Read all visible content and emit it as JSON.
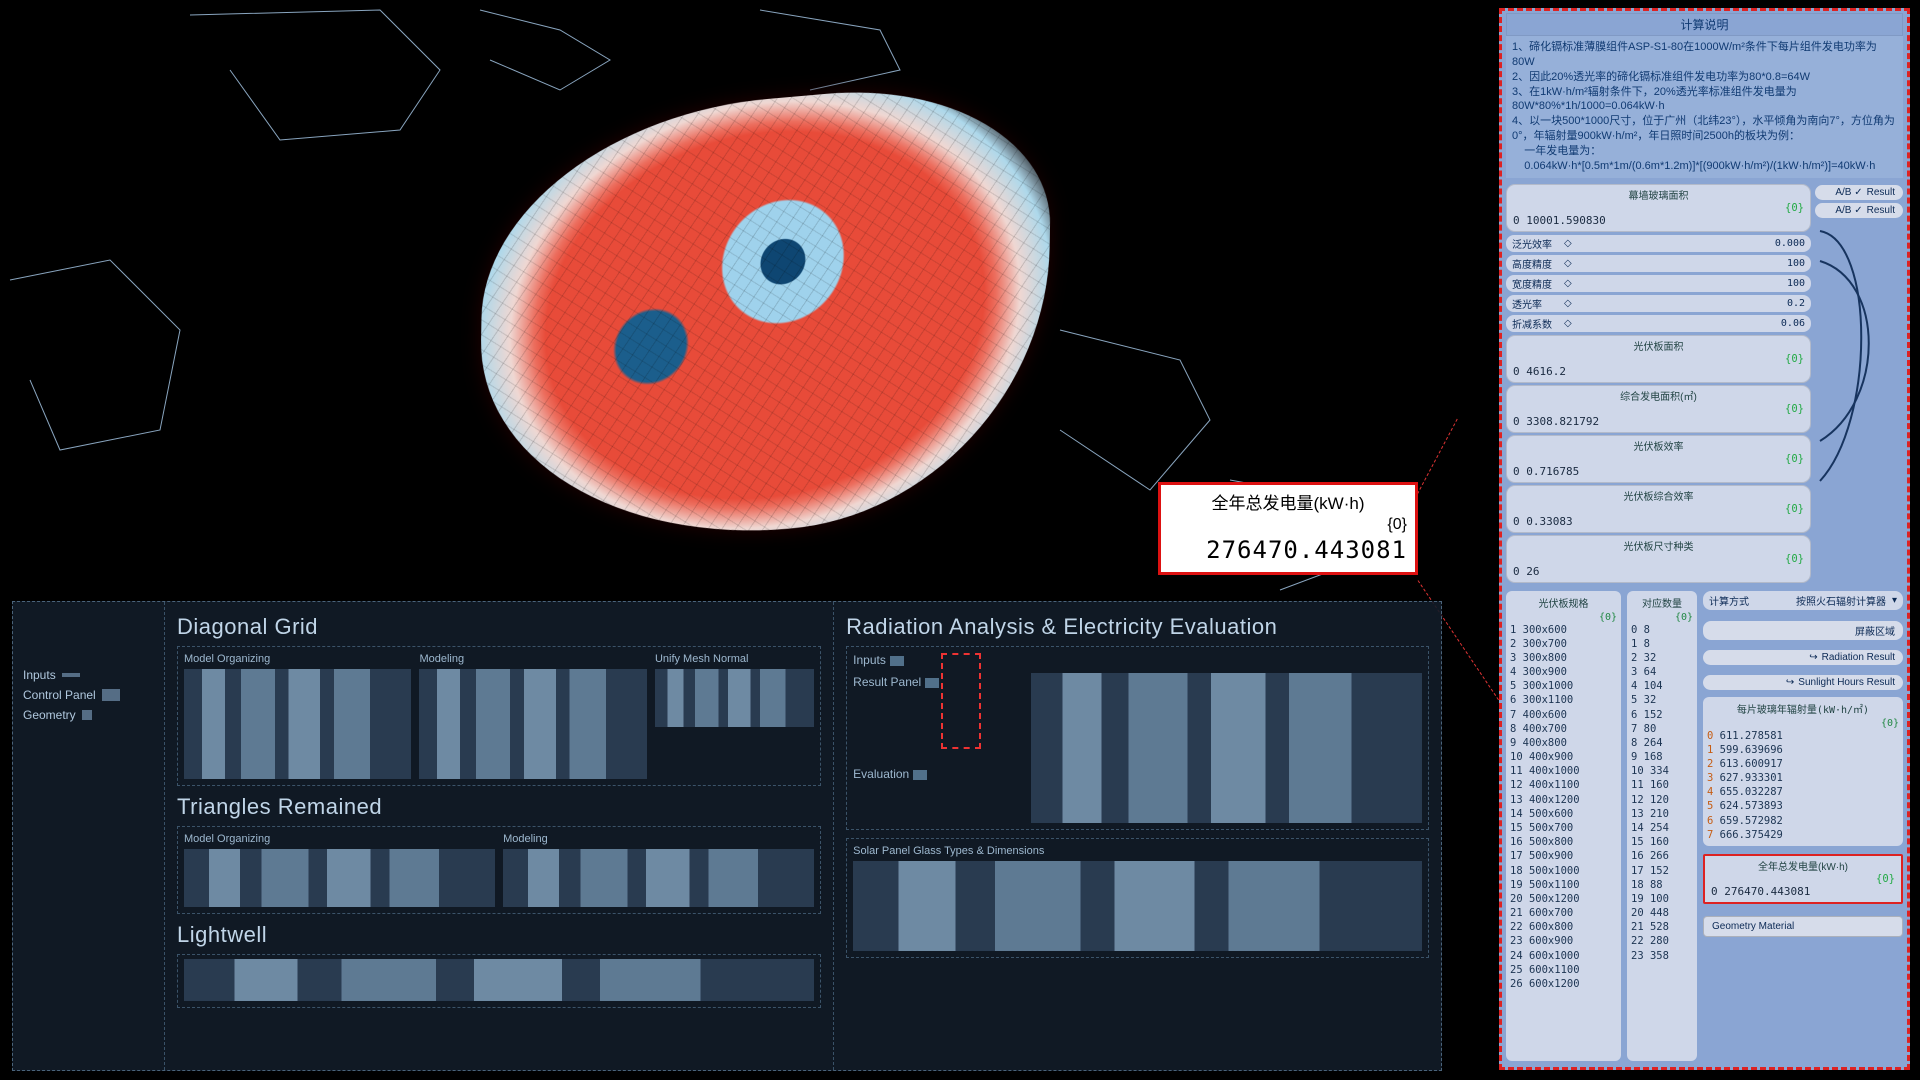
{
  "callout": {
    "title": "全年总发电量(kW·h)",
    "zero": "{0}",
    "value": "276470.443081"
  },
  "bottom": {
    "legend": {
      "inputs": "Inputs",
      "control_panel": "Control Panel",
      "geometry": "Geometry"
    },
    "diagonal": {
      "title": "Diagonal Grid",
      "model_org": "Model Organizing",
      "modeling": "Modeling",
      "unify": "Unify Mesh Normal"
    },
    "triangles": {
      "title": "Triangles Remained",
      "model_org": "Model Organizing",
      "modeling": "Modeling"
    },
    "lightwell": {
      "title": "Lightwell"
    },
    "rad": {
      "title": "Radiation Analysis & Electricity Evaluation",
      "inputs": "Inputs",
      "result_panel": "Result Panel",
      "evaluation": "Evaluation",
      "solar_types": "Solar Panel Glass Types & Dimensions"
    }
  },
  "inspector": {
    "title": "计算说明",
    "text": "1、碲化镉标准薄膜组件ASP-S1-80在1000W/m²条件下每片组件发电功率为80W\n2、因此20%透光率的碲化镉标准组件发电功率为80*0.8=64W\n3、在1kW·h/m²辐射条件下，20%透光率标准组件发电量为 80W*80%*1h/1000=0.064kW·h\n4、以一块500*1000尺寸，位于广州（北纬23°），水平倾角为南向7°，方位角为0°，年辐射量900kW·h/m²，年日照时间2500h的板块为例：\n    一年发电量为：\n    0.064kW·h*[0.5m*1m/(0.6m*1.2m)]*[(900kW·h/m²)/(1kW·h/m²)]=40kW·h",
    "sliders": [
      {
        "name": "泛光效率",
        "val": "0.000"
      },
      {
        "name": "高度精度",
        "val": "100"
      },
      {
        "name": "宽度精度",
        "val": "100"
      },
      {
        "name": "透光率",
        "val": "0.2"
      },
      {
        "name": "折减系数",
        "val": "0.06"
      }
    ],
    "readouts": {
      "glass_area": {
        "label": "幕墙玻璃面积",
        "zero": "{0}",
        "val": "0 10001.590830"
      },
      "pv_area": {
        "label": "光伏板面积",
        "zero": "{0}",
        "val": "0 4616.2"
      },
      "gen_area": {
        "label": "综合发电面积(㎡)",
        "zero": "{0}",
        "val": "0 3308.821792"
      },
      "pv_eff": {
        "label": "光伏板效率",
        "zero": "{0}",
        "val": "0 0.716785"
      },
      "pv_combo_eff": {
        "label": "光伏板综合效率",
        "zero": "{0}",
        "val": "0 0.33083"
      },
      "pv_dim_type": {
        "label": "光伏板尺寸种类",
        "zero": "{0}",
        "val": "0 26"
      }
    },
    "result_btns": [
      "Result",
      "Result"
    ],
    "calc_method": {
      "label": "计算方式",
      "value": "按照火石辐射计算器"
    },
    "side_btns": [
      "屏蔽区域",
      "Radiation Result",
      "Sunlight Hours Result"
    ],
    "dim_table": {
      "header": "光伏板规格",
      "rows": [
        "300x600",
        "300x700",
        "300x800",
        "300x900",
        "300x1000",
        "300x1100",
        "400x600",
        "400x700",
        "400x800",
        "400x900",
        "400x1000",
        "400x1100",
        "400x1200",
        "500x600",
        "500x700",
        "500x800",
        "500x900",
        "500x1000",
        "500x1100",
        "500x1200",
        "600x700",
        "600x800",
        "600x900",
        "600x1000",
        "600x1100",
        "600x1200"
      ]
    },
    "qty_table": {
      "header": "对应数量",
      "rows": [
        "8",
        "8",
        "32",
        "64",
        "104",
        "32",
        "152",
        "80",
        "264",
        "168",
        "334",
        "160",
        "120",
        "210",
        "254",
        "160",
        "266",
        "152",
        "88",
        "100",
        "448",
        "528",
        "280",
        "358"
      ]
    },
    "rad_table": {
      "header": "每片玻璃年辐射量(kW·h/㎡)",
      "rows": [
        "611.278581",
        "599.639696",
        "613.600917",
        "627.933301",
        "655.032287",
        "624.573893",
        "659.572982",
        "666.375429"
      ]
    },
    "annual": {
      "label": "全年总发电量(kW·h)",
      "zero": "{0}",
      "val": "0 276470.443081"
    },
    "geom_btn": "Geometry\nMaterial"
  }
}
